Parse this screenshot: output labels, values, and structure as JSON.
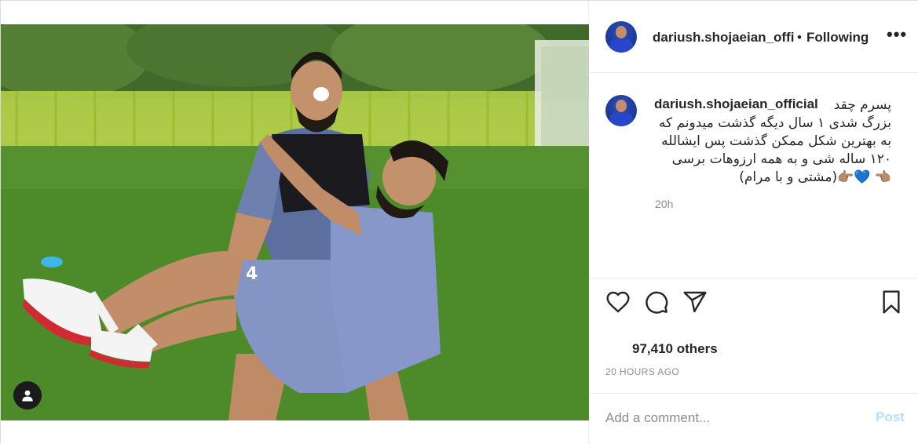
{
  "post": {
    "photo_alt": "",
    "username": "dariush.shojaeian_official",
    "username_truncated": "dariush.shojaeian_offic",
    "follow_separator": "•",
    "follow_label": "Following",
    "more_label": "•••",
    "caption_text_line1": "پسرم چقد",
    "caption_text_rest": "بزرگ شدی ۱ سال دیگه گذشت میدونم که به بهترین شکل ممکن گذشت پس ایشالله ۱۲۰ ساله شی و به همه ارزوهات برسی 👈🏽 💙👉🏽(مشتی و با مرام)",
    "caption_time": "20h",
    "likes_text": "97,410 others",
    "posted_time": "20 HOURS AGO",
    "comment_placeholder": "Add a comment...",
    "post_button": "Post"
  },
  "icons": {
    "like": "heart-icon",
    "comment": "comment-icon",
    "share": "share-icon",
    "save": "bookmark-icon",
    "tag": "user-tag-icon",
    "more": "more-options-icon"
  },
  "colors": {
    "post_button_disabled": "#b2dffc",
    "secondary_text": "#8e8e8e",
    "border": "#dbdbdb"
  }
}
